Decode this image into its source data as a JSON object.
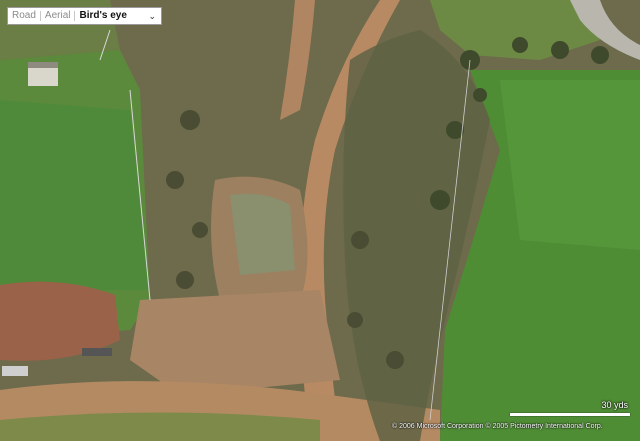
{
  "map_type_switcher": {
    "road_label": "Road",
    "aerial_label": "Aerial",
    "birds_eye_label": "Bird's eye",
    "selected": "Bird's eye",
    "dropdown_icon": "chevron-down-icon"
  },
  "scale_bar": {
    "label": "30 yds"
  },
  "copyright": {
    "text": "© 2006 Microsoft Corporation  © 2005 Pictometry International Corp."
  },
  "colors": {
    "grass": "#4f8a3a",
    "dirt_path": "#b88a63",
    "scrub": "#6e6a4c",
    "bare_soil": "#9c8060"
  }
}
